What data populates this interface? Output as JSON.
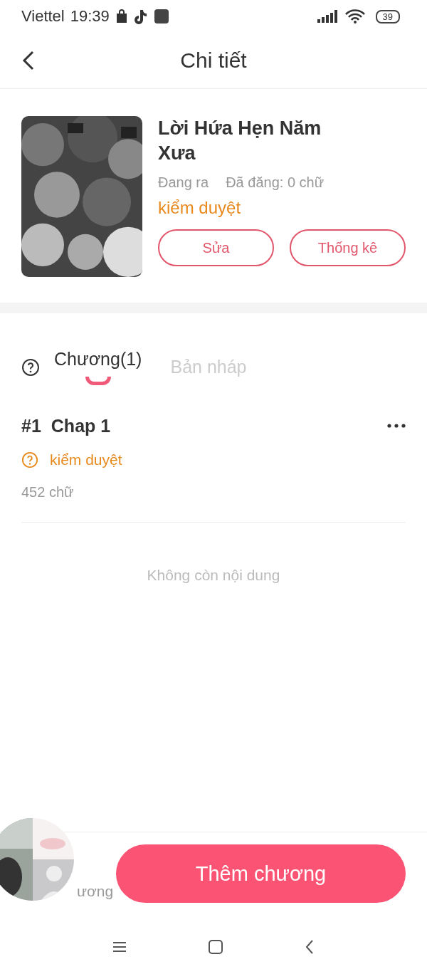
{
  "status_bar": {
    "carrier": "Viettel",
    "time": "19:39",
    "battery": "39"
  },
  "header": {
    "title": "Chi tiết"
  },
  "book": {
    "title": "Lời Hứa Hẹn Năm Xưa",
    "state": "Đang ra",
    "published": "Đã đăng: 0 chữ",
    "review": "kiểm duyệt",
    "buttons": [
      "Sửa",
      "Thống kê"
    ]
  },
  "tabs": [
    {
      "label": "Chương(1)",
      "selected": true
    },
    {
      "label": "Bản nháp",
      "selected": false
    }
  ],
  "chapters": [
    {
      "number": "#1",
      "title": "Chap 1",
      "status": "kiểm duyệt",
      "words": "452 chữ"
    }
  ],
  "empty_text": "Không còn nội dung",
  "bottom_bar": {
    "left_label": "ương",
    "add_button": "Thêm chương"
  }
}
